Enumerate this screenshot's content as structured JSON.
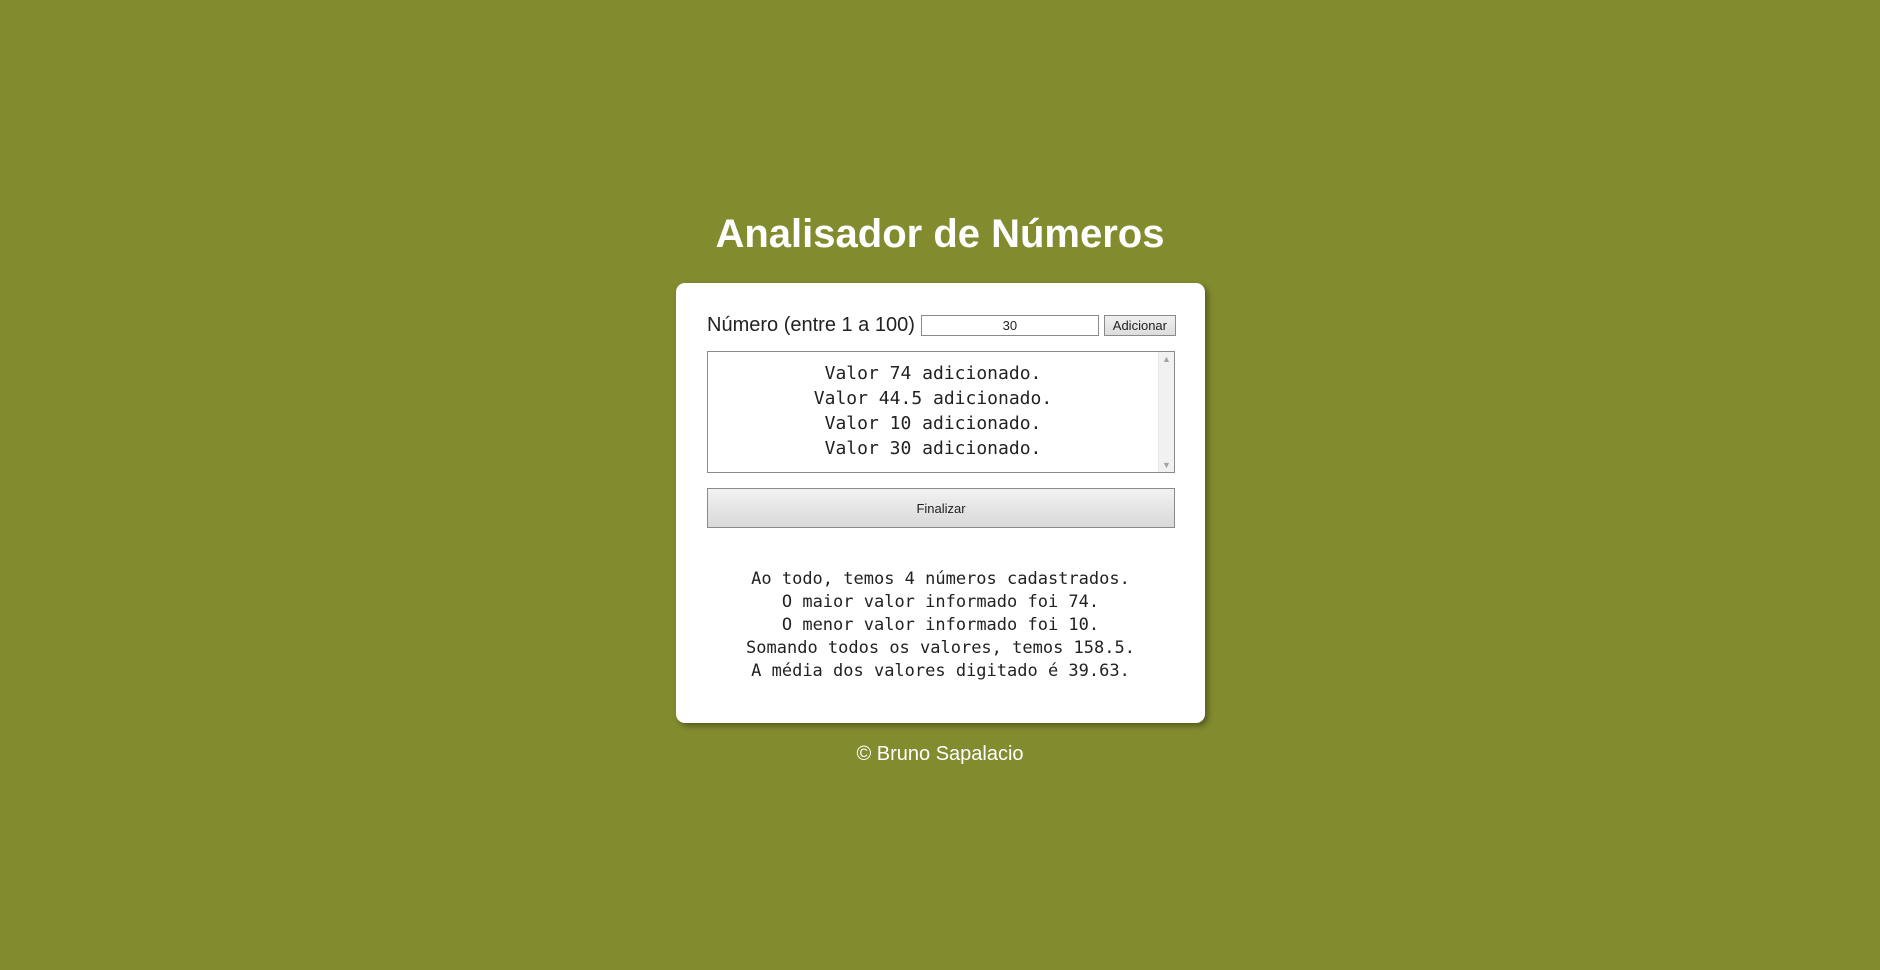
{
  "header": {
    "title": "Analisador de Números"
  },
  "form": {
    "label": "Número (entre 1 a 100)",
    "input_value": "30",
    "add_label": "Adicionar"
  },
  "log": {
    "items": [
      "Valor 74 adicionado.",
      "Valor 44.5 adicionado.",
      "Valor 10 adicionado.",
      "Valor 30 adicionado."
    ]
  },
  "finish_label": "Finalizar",
  "results": {
    "lines": [
      "Ao todo, temos 4 números cadastrados.",
      "O maior valor informado foi 74.",
      "O menor valor informado foi 10.",
      "Somando todos os valores, temos 158.5.",
      "A média dos valores digitado é 39.63."
    ]
  },
  "footer": {
    "text": "© Bruno Sapalacio"
  },
  "colors": {
    "background": "#828b2e",
    "card": "#ffffff",
    "title": "#ffffff"
  },
  "icons": {
    "scroll_up": "chevron-up-icon",
    "scroll_down": "chevron-down-icon"
  }
}
